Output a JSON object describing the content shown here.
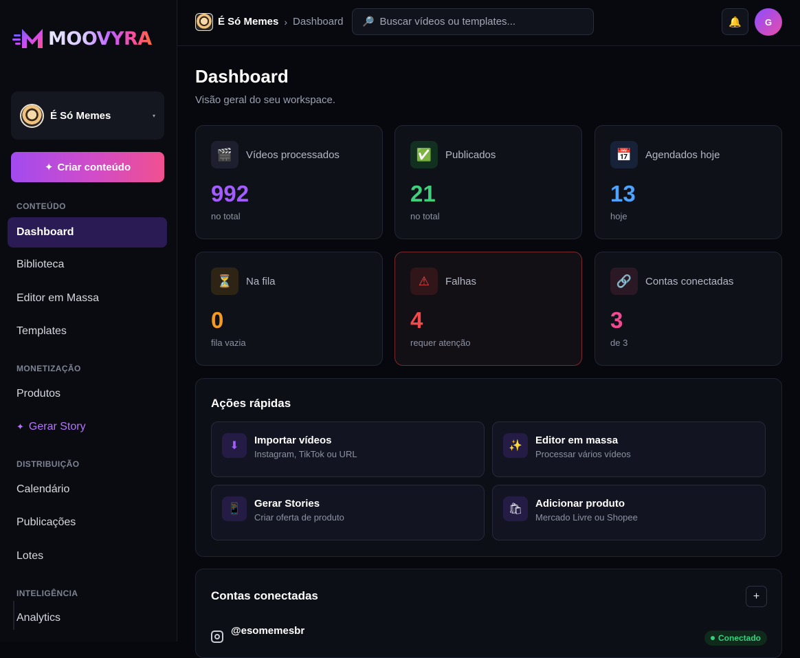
{
  "brand": {
    "logo_text": "MOOVYRA"
  },
  "workspace": {
    "name": "É Só Memes",
    "caret": "▾"
  },
  "sidebar": {
    "cta_label": "Criar conteúdo",
    "cta_icon": "✦",
    "sections": {
      "content": "CONTEÚDO",
      "monetization": "MONETIZAÇÃO",
      "distribution": "DISTRIBUIÇÃO",
      "intelligence": "INTELIGÊNCIA"
    },
    "items": {
      "dashboard": "Dashboard",
      "library": "Biblioteca",
      "bulk_editor": "Editor em Massa",
      "templates": "Templates",
      "products": "Produtos",
      "story_icon": "✦",
      "story": "Gerar Story",
      "calendar": "Calendário",
      "publications": "Publicações",
      "batches": "Lotes",
      "analytics": "Analytics"
    }
  },
  "topbar": {
    "workspace": "É Só Memes",
    "separator": "›",
    "current": "Dashboard",
    "search_icon": "🔎",
    "search_placeholder": "Buscar vídeos ou templates...",
    "bell_icon": "🔔",
    "user_initial": "G"
  },
  "page": {
    "title": "Dashboard",
    "subtitle": "Visão geral do seu workspace."
  },
  "stats": [
    {
      "icon": "🎬",
      "label": "Vídeos processados",
      "value": "992",
      "note": "no total",
      "color": "#a35cff"
    },
    {
      "icon": "✅",
      "label": "Publicados",
      "value": "21",
      "note": "no total",
      "color": "#3fd07c"
    },
    {
      "icon": "📅",
      "label": "Agendados hoje",
      "value": "13",
      "note": "hoje",
      "color": "#4ea3ff"
    },
    {
      "icon": "⏳",
      "label": "Na fila",
      "value": "0",
      "note": "fila vazia",
      "color": "#f59a1f"
    },
    {
      "icon": "⚠",
      "label": "Falhas",
      "value": "4",
      "note": "requer atenção",
      "color": "#f04a4a"
    },
    {
      "icon": "🔗",
      "label": "Contas conectadas",
      "value": "3",
      "note": "de 3",
      "color": "#f04a92"
    }
  ],
  "quick_actions": {
    "title": "Ações rápidas",
    "items": [
      {
        "icon": "⬇",
        "title": "Importar vídeos",
        "desc": "Instagram, TikTok ou URL"
      },
      {
        "icon": "✨",
        "title": "Editor em massa",
        "desc": "Processar vários vídeos"
      },
      {
        "icon": "📱",
        "title": "Gerar Stories",
        "desc": "Criar oferta de produto"
      },
      {
        "icon": "🛍",
        "title": "Adicionar produto",
        "desc": "Mercado Livre ou Shopee"
      }
    ]
  },
  "accounts": {
    "title": "Contas conectadas",
    "add_label": "+",
    "items": [
      {
        "handle": "@esomemesbr",
        "status": "Conectado"
      }
    ]
  }
}
